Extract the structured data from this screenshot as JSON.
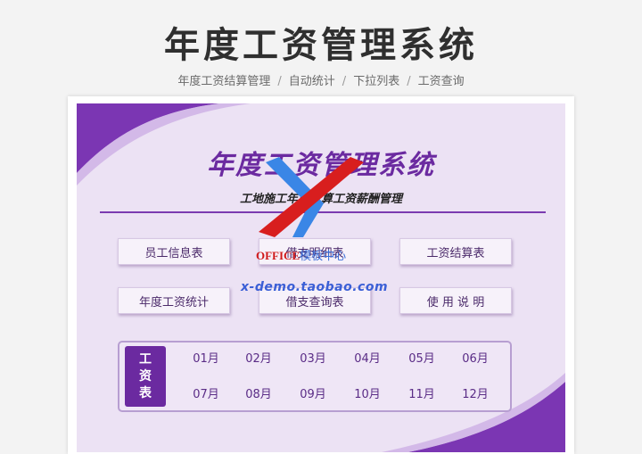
{
  "header": {
    "title": "年度工资管理系统",
    "features": [
      "年度工资结算管理",
      "自动统计",
      "下拉列表",
      "工资查询"
    ],
    "separator": "/"
  },
  "sheet": {
    "title": "年度工资管理系统",
    "subtitle": "工地施工年度计算工资薪酬管理",
    "accent_color": "#6b2aa0"
  },
  "menu": {
    "employee_info": "员工信息表",
    "loan_detail": "借支明细表",
    "salary_settlement": "工资结算表",
    "annual_stats": "年度工资统计",
    "loan_query": "借支查询表",
    "instructions": "使 用 说 明"
  },
  "salary": {
    "label": [
      "工",
      "资",
      "表"
    ],
    "months": [
      "01月",
      "02月",
      "03月",
      "04月",
      "05月",
      "06月",
      "07月",
      "08月",
      "09月",
      "10月",
      "11月",
      "12月"
    ]
  },
  "watermark": {
    "office_latin": "OFFICE",
    "office_cn": "模板中心",
    "demo_url": "x-demo.taobao.com"
  }
}
